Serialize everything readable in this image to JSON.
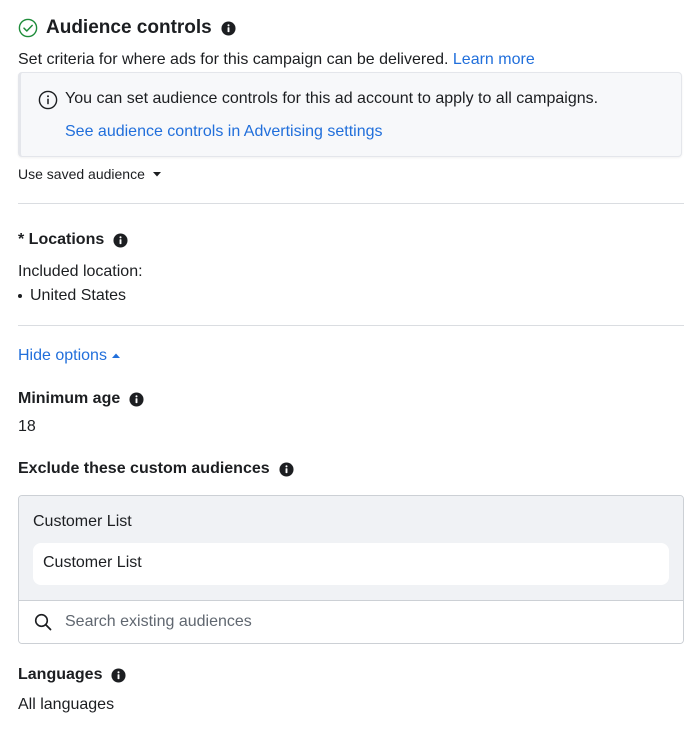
{
  "header": {
    "title": "Audience controls",
    "subtitle": "Set criteria for where ads for this campaign can be delivered.",
    "learn_more": "Learn more"
  },
  "notice": {
    "text": "You can set audience controls for this ad account to apply to all campaigns.",
    "link": "See audience controls in Advertising settings"
  },
  "saved_audience": {
    "label": "Use saved audience"
  },
  "locations": {
    "title": "* Locations",
    "included_label": "Included location:",
    "items": [
      "United States"
    ]
  },
  "options": {
    "toggle_label": "Hide options"
  },
  "minimum_age": {
    "title": "Minimum age",
    "value": "18"
  },
  "exclude_audiences": {
    "title": "Exclude these custom audiences",
    "group_label": "Customer List",
    "selected": [
      "Customer List"
    ],
    "search_placeholder": "Search existing audiences"
  },
  "languages": {
    "title": "Languages",
    "value": "All languages"
  },
  "colors": {
    "link": "#216fdb",
    "text": "#1c1e21",
    "muted": "#606770",
    "success": "#1e8c3a",
    "divider": "#dadde1"
  },
  "icons": {
    "header_status": "check-circle-icon",
    "info": "info-icon",
    "notice": "info-outline-icon",
    "dropdown": "caret-down-icon",
    "collapse": "caret-up-icon",
    "search": "search-icon"
  }
}
